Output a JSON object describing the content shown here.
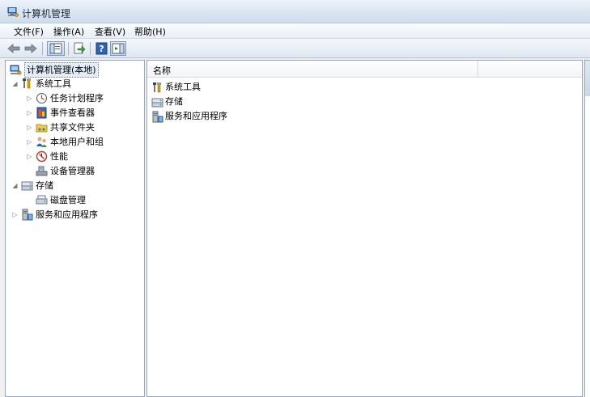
{
  "window": {
    "title": "计算机管理"
  },
  "menu": [
    {
      "label": "文件(F)"
    },
    {
      "label": "操作(A)"
    },
    {
      "label": "查看(V)"
    },
    {
      "label": "帮助(H)"
    }
  ],
  "toolbar": {
    "buttons": [
      "back-arrow-icon",
      "forward-arrow-icon",
      "show-hide-console-tree-icon",
      "export-list-icon",
      "help-icon",
      "show-hide-action-pane-icon"
    ]
  },
  "tree": {
    "root": "计算机管理(本地)",
    "items": [
      {
        "label": "系统工具",
        "level": 1,
        "expanded": true
      },
      {
        "label": "任务计划程序",
        "level": 2
      },
      {
        "label": "事件查看器",
        "level": 2
      },
      {
        "label": "共享文件夹",
        "level": 2
      },
      {
        "label": "本地用户和组",
        "level": 2
      },
      {
        "label": "性能",
        "level": 2
      },
      {
        "label": "设备管理器",
        "level": 2
      },
      {
        "label": "存储",
        "level": 1,
        "expanded": true
      },
      {
        "label": "磁盘管理",
        "level": 2
      },
      {
        "label": "服务和应用程序",
        "level": 1,
        "expanded": false
      }
    ]
  },
  "list": {
    "column_name": "名称",
    "rows": [
      {
        "label": "系统工具"
      },
      {
        "label": "存储"
      },
      {
        "label": "服务和应用程序"
      }
    ]
  },
  "colors": {
    "accent": "#3a6ea5",
    "selection": "#e3ecf7",
    "pane_border": "#9aa7b8"
  }
}
